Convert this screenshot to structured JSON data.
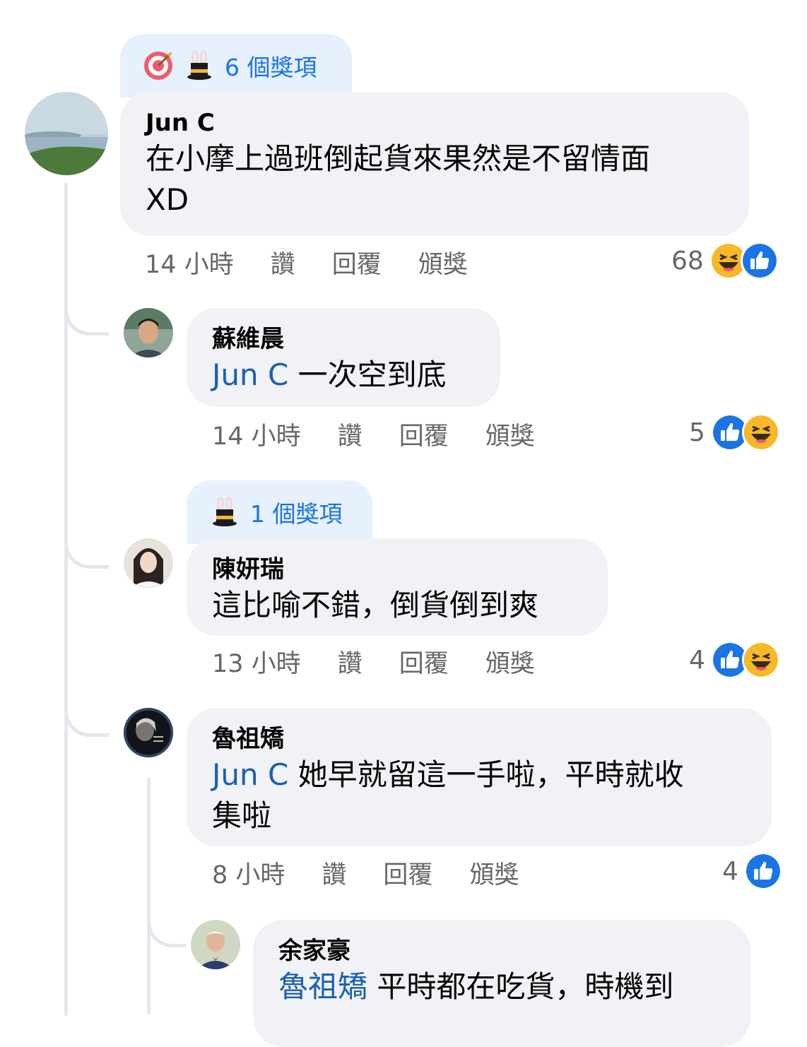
{
  "comments": [
    {
      "awards": "6 個獎項",
      "author": "Jun C",
      "line1": "在小摩上過班倒起貨來果然是不留情面",
      "line2": "XD",
      "time": "14 小時",
      "like": "讚",
      "reply": "回覆",
      "award": "頒獎",
      "reaction_count": "68",
      "reactions": [
        "haha-icon",
        "like-icon"
      ]
    },
    {
      "author": "蘇維晨",
      "mention": "Jun C",
      "text": "一次空到底",
      "time": "14 小時",
      "like": "讚",
      "reply": "回覆",
      "award": "頒獎",
      "reaction_count": "5",
      "reactions": [
        "like-icon",
        "haha-icon"
      ]
    },
    {
      "awards": "1 個獎項",
      "author": "陳妍瑞",
      "text": "這比喻不錯，倒貨倒到爽",
      "time": "13 小時",
      "like": "讚",
      "reply": "回覆",
      "award": "頒獎",
      "reaction_count": "4",
      "reactions": [
        "like-icon",
        "haha-icon"
      ]
    },
    {
      "author": "魯祖矯",
      "mention": "Jun C",
      "line1": "她早就留這一手啦，平時就收",
      "line2": "集啦",
      "time": "8 小時",
      "like": "讚",
      "reply": "回覆",
      "award": "頒獎",
      "reaction_count": "4",
      "reactions": [
        "like-icon"
      ]
    },
    {
      "author": "余家豪",
      "mention": "魯祖矯",
      "text": "平時都在吃貨，時機到"
    }
  ],
  "colors": {
    "bubble": "#f0f2f5",
    "award_tab": "#e7f0fd",
    "link": "#1b74e4",
    "meta": "#65676b"
  }
}
